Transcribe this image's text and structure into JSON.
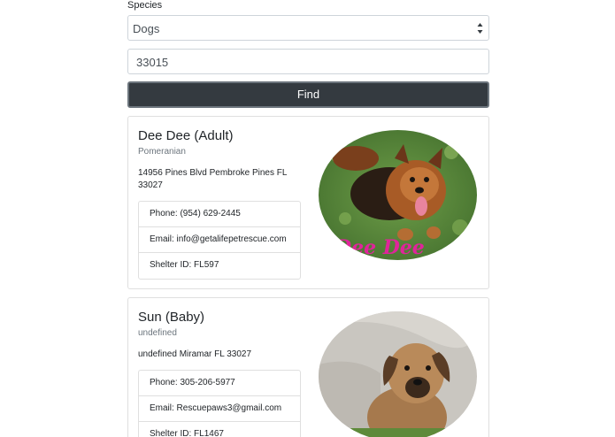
{
  "form": {
    "species_label": "Species",
    "species_value": "Dogs",
    "zip_value": "33015",
    "find_label": "Find"
  },
  "results": [
    {
      "name": "Dee Dee (Adult)",
      "breed": "Pomeranian",
      "address": "14956 Pines Blvd Pembroke Pines FL 33027",
      "phone": "Phone: (954) 629-2445",
      "email": "Email: info@getalifepetrescue.com",
      "shelter": "Shelter ID: FL597",
      "photo_caption": "Dee Dee"
    },
    {
      "name": "Sun (Baby)",
      "breed": "undefined",
      "address": "undefined Miramar FL 33027",
      "phone": "Phone: 305-206-5977",
      "email": "Email: Rescuepaws3@gmail.com",
      "shelter": "Shelter ID: FL1467"
    }
  ],
  "colors": {
    "button_bg": "#343a40",
    "muted_text": "#6c757d",
    "caption_pink": "#e0249b"
  },
  "icons": {
    "select_arrows": "chevron-up-down-icon"
  }
}
